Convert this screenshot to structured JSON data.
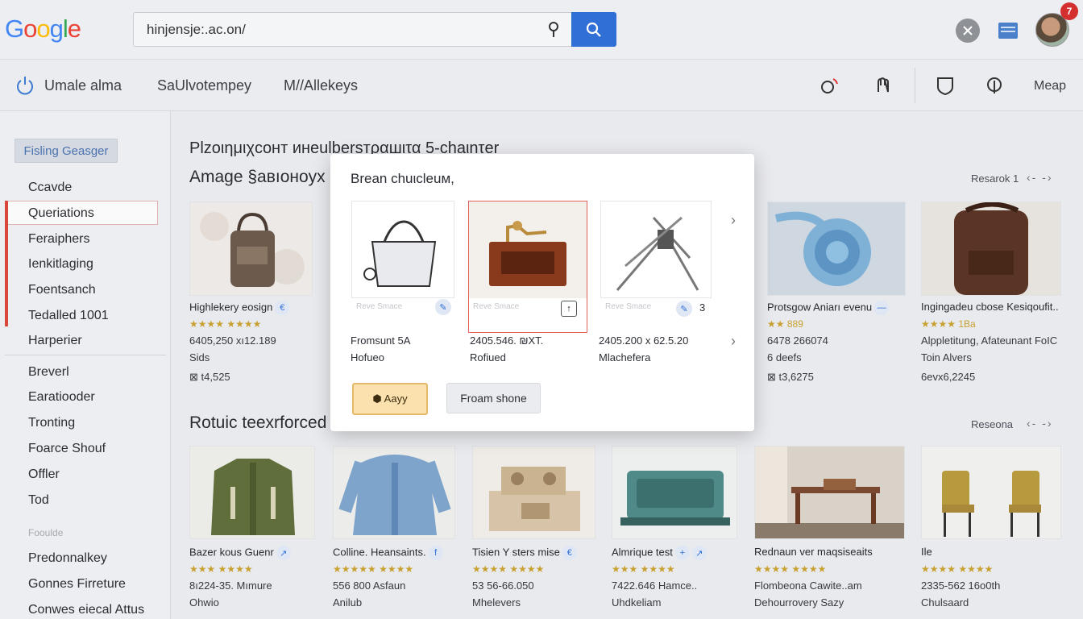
{
  "header": {
    "search_value": "hinjensje:.ac.on/",
    "notification_count": "7"
  },
  "nav": {
    "item1": "Umale alma",
    "item2": "SaUlvotempey",
    "item3": "M//Allekeys",
    "map": "Meap"
  },
  "sidebar": {
    "heading": "Fisling Geasger",
    "items": [
      "Ccavde",
      "Queriations",
      "Feraiphers",
      "Ienkitlaging",
      "Foentsanch",
      "Tedalled 1001",
      "Harperier"
    ],
    "items2": [
      "Breverl",
      "Earatiooder",
      "Tronting",
      "Foarce Shouf",
      "Offler",
      "Tod"
    ],
    "faint": "Fooulde",
    "items3": [
      "Predonnalkey",
      "Gonnes Firreture",
      "Conwes eiecal Attus"
    ]
  },
  "content": {
    "heading1": "Plzoιημιχcoнт инеulbersтραшιτα 5-chaιnτer",
    "heading2": "Amage §aвıoнoyx",
    "heading3": "Rotuic teexrforced",
    "section1_link": "Resarok 1",
    "section2_link": "Reseona",
    "row1": [
      {
        "title": "Highlekery eosign",
        "stars": "★★★★ ★★★★",
        "line1": "6405,250 xı12.189",
        "line2": "Sids",
        "line3": "⊠ t4,525"
      },
      {
        "title": "Protsgow Aniarı evenu",
        "stars": "★★ 889",
        "line1": "6478 266074",
        "line2": "6 deefs",
        "line3": "⊠ t3,6275"
      },
      {
        "title": "Ingingadeu cbose Kesiqoufit..",
        "stars": "★★★★ 1Ba",
        "line1": "Alppletitung, Afateunant FoIC",
        "line2": "Toin Alvers",
        "line3": "6evx6,2245"
      }
    ],
    "row2": [
      {
        "title": "Bazer kous Guenr",
        "stars": "★★★ ★★★★",
        "line1": "8ı224-35. Mımure",
        "line2": "Ohwio"
      },
      {
        "title": "Colline. Heansaints.",
        "stars": "★★★★★ ★★★★",
        "line1": "556 800 Asfaun",
        "line2": "Anilub"
      },
      {
        "title": "Tisien Y sters mise",
        "stars": "★★★★ ★★★★",
        "line1": "53 56-66.050",
        "line2": "Mhelevers"
      },
      {
        "title": "Almrique test",
        "stars": "★★★ ★★★★",
        "line1": "7422.646 Hamce..",
        "line2": "Uhdkeliam"
      },
      {
        "title": "Rednaun ver maqsiseaits",
        "stars": "★★★★ ★★★★",
        "line1": "Flombeona Cawite..am",
        "line2": "Dehourrovery Sazy"
      },
      {
        "title": "Ile",
        "stars": "★★★★ ★★★★",
        "line1": "2335-562 16o0th",
        "line2": "Chulsaard"
      }
    ]
  },
  "modal": {
    "title": "Brean chuιcleuм,",
    "items": [
      {
        "faint": "Reve Smace",
        "label1": "Fromsunt 5A",
        "label2": "Hofueo"
      },
      {
        "faint": "Reve Smace",
        "label1": "2405.546. ₪XT.",
        "label2": "Rofiued"
      },
      {
        "faint": "Reve Smace",
        "label1": "2405.200 x 62.5.20",
        "label2": "Mlachefera",
        "count": "3"
      }
    ],
    "buy_label": "⬢ Aayy",
    "from_label": "Froam shone"
  },
  "colors": {
    "accent": "#2f6fd6",
    "active_bar": "#d9473b",
    "buy_bg": "#fbe1ad"
  }
}
